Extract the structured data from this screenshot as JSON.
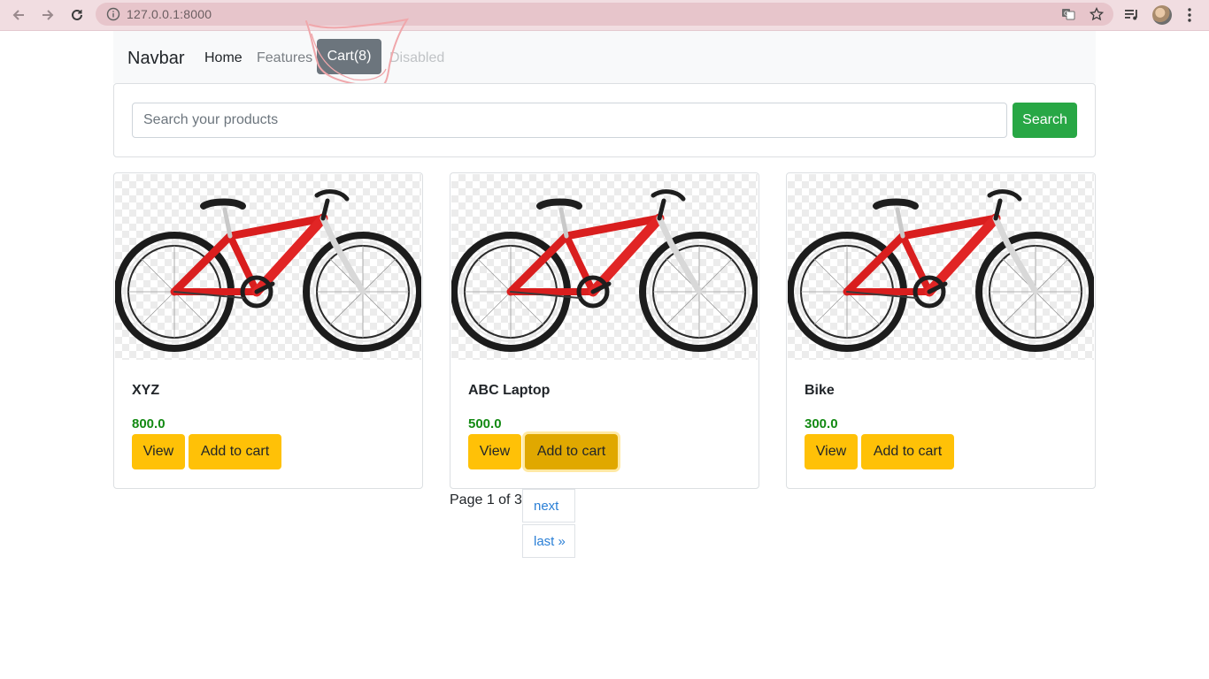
{
  "browser": {
    "url": "127.0.0.1:8000",
    "icons": [
      "back-icon",
      "forward-icon",
      "reload-icon",
      "info-icon",
      "translate-icon",
      "star-icon",
      "media-control-icon",
      "avatar",
      "menu-kebab-icon"
    ]
  },
  "navbar": {
    "brand": "Navbar",
    "links": {
      "home": "Home",
      "features": "Features",
      "cart": "Cart(8)",
      "disabled": "Disabled"
    }
  },
  "search": {
    "placeholder": "Search your products",
    "button_label": "Search"
  },
  "products": [
    {
      "name": "XYZ",
      "price": "800.0",
      "view_label": "View",
      "add_label": "Add to cart"
    },
    {
      "name": "ABC Laptop",
      "price": "500.0",
      "view_label": "View",
      "add_label": "Add to cart"
    },
    {
      "name": "Bike",
      "price": "300.0",
      "view_label": "View",
      "add_label": "Add to cart"
    }
  ],
  "pagination": {
    "status": "Page 1 of 3.",
    "next": "next",
    "last": "last »"
  },
  "colors": {
    "accent_yellow": "#ffc107",
    "search_green": "#28a745",
    "cart_gray": "#6c757d",
    "price_green": "#138a13",
    "link_blue": "#2a7fd6"
  }
}
